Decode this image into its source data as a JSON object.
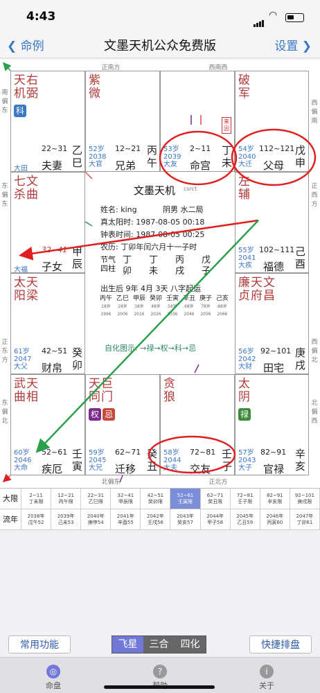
{
  "status": {
    "time": "4:43"
  },
  "nav": {
    "back": "命例",
    "title": "文墨天机公众免费版",
    "settings": "设置"
  },
  "directions": {
    "top_c": "正南方",
    "top_r": "西南西",
    "left1": "南偏东",
    "left2": "东偏东",
    "left3": "正东方",
    "left4": "东偏北",
    "right1": "西偏南",
    "right2": "正西方",
    "right3": "西偏北",
    "right4": "北偏西",
    "bottom_c": "北偏东",
    "bottom_r": "正北方"
  },
  "palaces": {
    "si": {
      "stars": [
        "天",
        "机"
      ],
      "stars2": [
        "右",
        "弼"
      ],
      "badge": "科",
      "range": "22~31",
      "name": "夫妻",
      "branch": [
        "乙",
        "巳"
      ],
      "small": "大田"
    },
    "wu": {
      "stars": [
        "紫",
        "微"
      ],
      "age": "52岁",
      "year": "2038",
      "range": "12~21",
      "name": "兄弟",
      "branch": [
        "丙",
        "午"
      ],
      "small": "大官"
    },
    "wei": {
      "age": "53岁",
      "year": "2039",
      "range": "2~11",
      "name": "命宫",
      "branch": [
        "丁",
        "未"
      ],
      "small": "大友",
      "tag": "来因"
    },
    "shen": {
      "stars": [
        "破",
        "军"
      ],
      "age": "54岁",
      "year": "2040",
      "range": "112~121",
      "name": "父母",
      "branch": [
        "戊",
        "申"
      ],
      "small": "大迁"
    },
    "chen": {
      "stars": [
        "七",
        "杀"
      ],
      "stars2": [
        "文",
        "曲"
      ],
      "range": "32~41",
      "name": "子女",
      "branch": [
        "甲",
        "辰"
      ],
      "small": "大福"
    },
    "you": {
      "stars": [
        "左",
        "辅"
      ],
      "age": "55岁",
      "year": "2041",
      "range": "102~111",
      "name": "福德",
      "branch": [
        "己",
        "酉"
      ],
      "small": "大疾"
    },
    "mao": {
      "stars": [
        "太",
        "阳"
      ],
      "stars2": [
        "天",
        "梁"
      ],
      "age": "61岁",
      "year": "2047",
      "range": "42~51",
      "name": "财帛",
      "branch": [
        "癸",
        "卯"
      ],
      "small": "大父"
    },
    "xu": {
      "stars": [
        "廉",
        "贞"
      ],
      "stars2": [
        "天",
        "府"
      ],
      "stars3": [
        "文",
        "昌"
      ],
      "age": "56岁",
      "year": "2042",
      "range": "92~101",
      "name": "田宅",
      "branch": [
        "庚",
        "戌"
      ],
      "small": "大财"
    },
    "yin": {
      "stars": [
        "武",
        "曲"
      ],
      "stars2": [
        "天",
        "相"
      ],
      "age": "60岁",
      "year": "2046",
      "range": "52~61",
      "name": "疾厄",
      "branch": [
        "壬",
        "寅"
      ],
      "small": "大命"
    },
    "chou": {
      "stars": [
        "天",
        "同"
      ],
      "stars2": [
        "巨",
        "门"
      ],
      "badge1": "权",
      "badge2": "忌",
      "age": "59岁",
      "year": "2045",
      "range": "62~71",
      "name": "迁移",
      "branch": [
        "癸",
        "丑"
      ],
      "small": "大兄"
    },
    "zi": {
      "stars": [
        "贪",
        "狼"
      ],
      "age": "58岁",
      "year": "2044",
      "range": "72~81",
      "name": "交友",
      "branch": [
        "壬",
        "子"
      ],
      "small": "大夫"
    },
    "hai": {
      "stars": [
        "太",
        "阴"
      ],
      "badge": "禄",
      "age": "57岁",
      "year": "2043",
      "range": "82~91",
      "name": "官禄",
      "branch": [
        "辛",
        "亥"
      ],
      "small": "大子"
    }
  },
  "center": {
    "title": "文墨天机",
    "title2": "csrct",
    "name": "姓名: king",
    "gender": "阴男 水二局",
    "solar": "真太阳时: 1987-08-05 00:18",
    "clock": "钟表时间: 1987-08-05 00:25",
    "lunar": "农历: 丁卯年闰六月十一子时",
    "jieqi": "节气\n四柱",
    "pillars": [
      [
        "丁",
        "卯"
      ],
      [
        "丁",
        "未"
      ],
      [
        "丙",
        "戌"
      ],
      [
        "戊",
        "子"
      ]
    ],
    "qiyun": "出生后 9年 4月 3天 八字起运",
    "bazi_top": [
      "丙午",
      "乙巳",
      "甲辰",
      "癸卯",
      "壬寅",
      "辛丑",
      "庚子",
      "己亥"
    ],
    "bazi_age": [
      "18岁",
      "28岁",
      "38岁",
      "48岁",
      "58岁",
      "68岁",
      "78岁",
      "88岁"
    ],
    "bazi_year": [
      "1996",
      "2006",
      "2016",
      "2026",
      "2036",
      "2046",
      "2056",
      "2066"
    ],
    "sihua": "自化图示: →禄→权→科→忌"
  },
  "dayun": {
    "h1": "大限",
    "h2": "流年",
    "row1": [
      [
        "2~11",
        "丁未限"
      ],
      [
        "12~21",
        "丙午限"
      ],
      [
        "22~31",
        "乙巳限"
      ],
      [
        "32~41",
        "甲辰限"
      ],
      [
        "42~51",
        "癸卯限"
      ],
      [
        "52~61",
        "壬寅限"
      ],
      [
        "62~71",
        "癸丑限"
      ],
      [
        "72~81",
        "壬子限"
      ],
      [
        "82~91",
        "辛亥限"
      ],
      [
        "92~101",
        "庚戌限"
      ]
    ],
    "row2": [
      [
        "2038年",
        "戊午52"
      ],
      [
        "2039年",
        "己未53"
      ],
      [
        "2040年",
        "庚申54"
      ],
      [
        "2041年",
        "辛酉55"
      ],
      [
        "2042年",
        "壬戌56"
      ],
      [
        "2043年",
        "癸亥57"
      ],
      [
        "2044年",
        "甲子58"
      ],
      [
        "2045年",
        "乙丑59"
      ],
      [
        "2046年",
        "丙寅60"
      ],
      [
        "2047年",
        "丁卯61"
      ]
    ]
  },
  "buttons": {
    "common": "常用功能",
    "fly": "飞星",
    "sanhe": "三合",
    "sihua": "四化",
    "quick": "快捷排盘"
  },
  "tabs": {
    "t1": "命盘",
    "t2": "帮助",
    "t3": "关于"
  },
  "colors": {
    "accent": "#3a76c6",
    "star": "#b23a3a",
    "annot": "#e02020",
    "arrow": "#2aa04a"
  }
}
